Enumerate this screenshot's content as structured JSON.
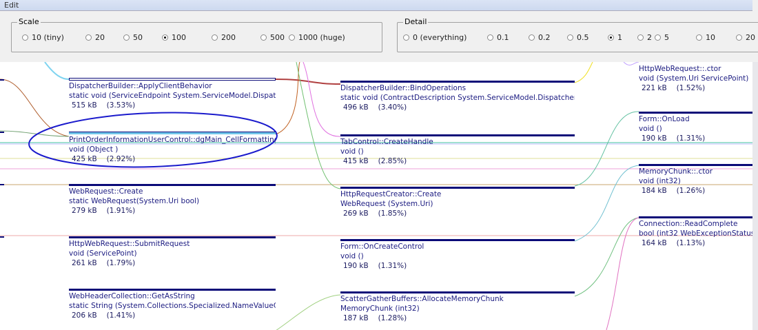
{
  "menu": {
    "label": "Edit"
  },
  "scale": {
    "label": "Scale",
    "options": [
      "10 (tiny)",
      "20",
      "50",
      "100",
      "200",
      "500",
      "1000 (huge)"
    ],
    "selected": "100"
  },
  "detail": {
    "label": "Detail",
    "options": [
      "0 (everything)",
      "0.1",
      "0.2",
      "0.5",
      "1",
      "2",
      "5",
      "10",
      "20"
    ],
    "selected": "1"
  },
  "nodes": [
    {
      "name": "DispatcherBuilder::ApplyClientBehavior",
      "sig": "static void (ServiceEndpoint System.ServiceModel.Dispatch",
      "size": "515 kB",
      "pct": "(3.53%)"
    },
    {
      "name": "PrintOrderInformationUserControl::dgMain_CellFormatting",
      "sig": "void (Object )",
      "size": "425 kB",
      "pct": "(2.92%)"
    },
    {
      "name": "WebRequest::Create",
      "sig": "static WebRequest(System.Uri bool)",
      "size": "279 kB",
      "pct": "(1.91%)"
    },
    {
      "name": "HttpWebRequest::SubmitRequest",
      "sig": "void (ServicePoint)",
      "size": "261 kB",
      "pct": "(1.79%)"
    },
    {
      "name": "WebHeaderCollection::GetAsString",
      "sig": "static String (System.Collections.Specialized.NameValueCol",
      "size": "206 kB",
      "pct": "(1.41%)"
    },
    {
      "name": "DispatcherBuilder::BindOperations",
      "sig": "static void (ContractDescription System.ServiceModel.Dispatcher.Cl",
      "size": "496 kB",
      "pct": "(3.40%)"
    },
    {
      "name": "TabControl::CreateHandle",
      "sig": "void ()",
      "size": "415 kB",
      "pct": "(2.85%)"
    },
    {
      "name": "HttpRequestCreator::Create",
      "sig": "WebRequest (System.Uri)",
      "size": "269 kB",
      "pct": "(1.85%)"
    },
    {
      "name": "Form::OnCreateControl",
      "sig": "void ()",
      "size": "190 kB",
      "pct": "(1.31%)"
    },
    {
      "name": "ScatterGatherBuffers::AllocateMemoryChunk",
      "sig": "MemoryChunk (int32)",
      "size": "187 kB",
      "pct": "(1.28%)"
    },
    {
      "name": "HttpWebRequest::.ctor",
      "sig": "void (System.Uri ServicePoint)",
      "size": "221 kB",
      "pct": "(1.52%)"
    },
    {
      "name": "Form::OnLoad",
      "sig": "void ()",
      "size": "190 kB",
      "pct": "(1.31%)"
    },
    {
      "name": "MemoryChunk::.ctor",
      "sig": "void (int32)",
      "size": "184 kB",
      "pct": "(1.26%)"
    },
    {
      "name": "Connection::ReadComplete",
      "sig": "bool (int32 WebExceptionStatus",
      "size": "164 kB",
      "pct": "(1.13%)"
    }
  ],
  "colors": {
    "node_bar": "#0a0a78",
    "annotation": "#1a1acc"
  }
}
